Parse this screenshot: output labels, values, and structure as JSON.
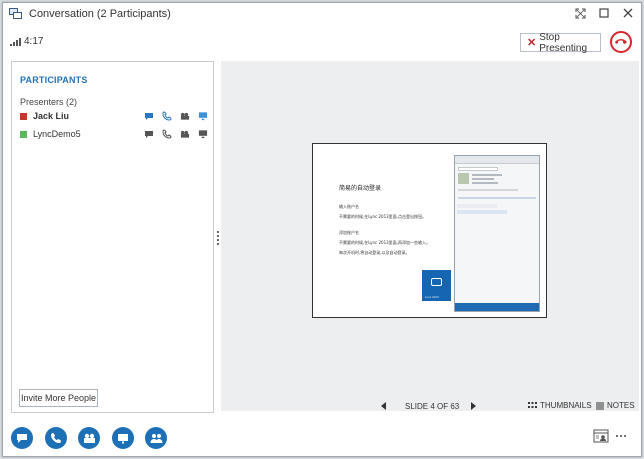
{
  "window": {
    "title": "Conversation (2 Participants)",
    "app_icon": "lync-conversation-icon"
  },
  "status": {
    "call_duration": "4:17",
    "signal_icon": "signal-strength-icon",
    "stop_presenting_label": "Stop Presenting",
    "hangup_icon": "hang-up-icon",
    "hangup_color": "#d6262e"
  },
  "participants": {
    "title": "PARTICIPANTS",
    "group_label": "Presenters (2)",
    "list": [
      {
        "name": "Jack Liu",
        "presence_color": "#c0392b"
      },
      {
        "name": "LyncDemo5",
        "presence_color": "#5cb85c"
      }
    ],
    "invite_label": "Invite More People"
  },
  "slide": {
    "title": "简易的自动登录",
    "lines": [
      "输入账户名",
      "不需要的时候,在Lync 2013里面,点击登出按钮。",
      "添加账户名",
      "不需要的时候,在Lync 2013里面,再添加一些输入。",
      "每次开机时,将自动登录,以及自动登录。"
    ],
    "tile_text": "Lync 2013"
  },
  "stage": {
    "slide_counter": "SLIDE 4 OF 63",
    "thumbnails_label": "THUMBNAILS",
    "notes_label": "NOTES"
  },
  "toolbar": {
    "accent": "#1d6fb6",
    "buttons": [
      "im-icon",
      "call-icon",
      "video-icon",
      "present-icon",
      "participants-icon"
    ]
  }
}
